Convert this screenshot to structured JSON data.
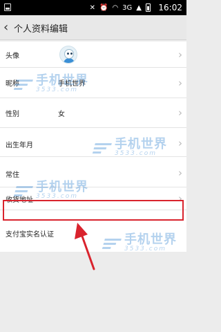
{
  "status_bar": {
    "time": "16:02",
    "network": "3G"
  },
  "header": {
    "title": "个人资料编辑"
  },
  "rows": [
    {
      "label": "头像",
      "value": ""
    },
    {
      "label": "昵称",
      "value": "手机世界"
    },
    {
      "label": "性别",
      "value": "女"
    },
    {
      "label": "出生年月",
      "value": ""
    },
    {
      "label": "常住",
      "value": ""
    },
    {
      "label": "收货地址",
      "value": ""
    },
    {
      "label": "支付宝实名认证",
      "value": ""
    }
  ],
  "watermark": {
    "brand": "手机世界",
    "site": "3533.com"
  },
  "colors": {
    "highlight": "#d9232d",
    "watermark": "#2c7fd1"
  },
  "icons": {
    "back": "chevron-left-icon",
    "row": "chevron-right-icon"
  }
}
